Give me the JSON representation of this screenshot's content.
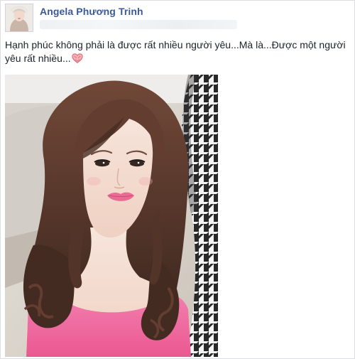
{
  "post": {
    "author": "Angela Phương Trinh",
    "status_text": "Hạnh phúc không phải là được rất nhiều người yêu...Mà là...Được một người yêu rất nhiều...",
    "emoji": "heart-icon",
    "photo": "selfie-photo"
  },
  "colors": {
    "author_link": "#3b5998",
    "text": "#1d2129",
    "top_pink": "#f06aa0",
    "heart": "#e8868c"
  }
}
